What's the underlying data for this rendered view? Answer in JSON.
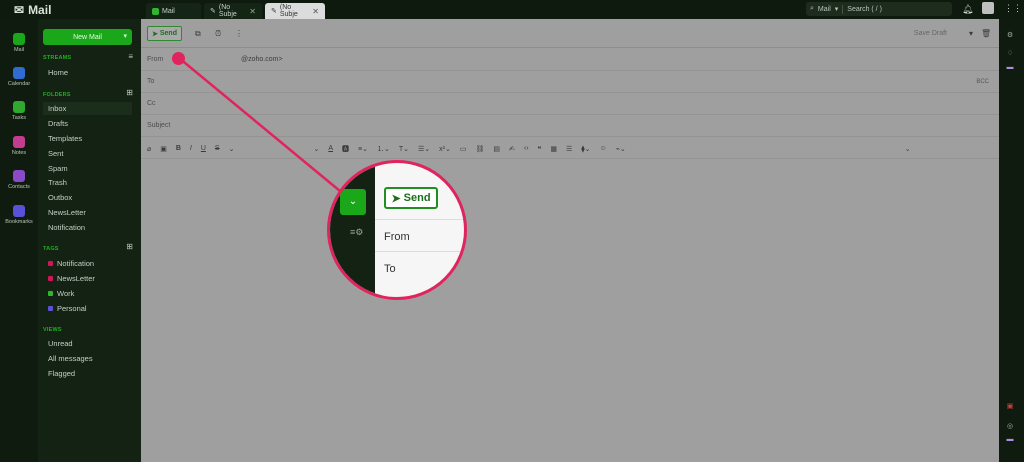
{
  "topbar": {
    "brand": "Mail",
    "tabs": [
      {
        "label": "Mail"
      },
      {
        "label": "(No Subje"
      },
      {
        "label": "(No Subje"
      }
    ],
    "search_scope": "Mail",
    "search_placeholder": "Search ( / )"
  },
  "rail": {
    "items": [
      {
        "label": "Mail",
        "color": "#1aa81a"
      },
      {
        "label": "Calendar",
        "color": "#2f6bd0"
      },
      {
        "label": "Tasks",
        "color": "#2fa82f"
      },
      {
        "label": "Notes",
        "color": "#c23d8f"
      },
      {
        "label": "Contacts",
        "color": "#8b4bc7"
      },
      {
        "label": "Bookmarks",
        "color": "#5a52d6"
      }
    ]
  },
  "panel": {
    "new_mail": "New Mail",
    "streams_heading": "STREAMS",
    "streams_items": [
      "Home"
    ],
    "folders_heading": "FOLDERS",
    "folders": [
      "Inbox",
      "Drafts",
      "Templates",
      "Sent",
      "Spam",
      "Trash",
      "Outbox",
      "NewsLetter",
      "Notification"
    ],
    "tags_heading": "TAGS",
    "tags": [
      {
        "label": "Notification",
        "color": "#d2145a"
      },
      {
        "label": "NewsLetter",
        "color": "#d2145a"
      },
      {
        "label": "Work",
        "color": "#2fb52f"
      },
      {
        "label": "Personal",
        "color": "#5a52d6"
      }
    ],
    "views_heading": "VIEWS",
    "views": [
      "Unread",
      "All messages",
      "Flagged"
    ]
  },
  "compose": {
    "send_label": "Send",
    "save_draft": "Save Draft",
    "from_label": "From",
    "from_value": "@zoho.com>",
    "to_label": "To",
    "cc_label": "Cc",
    "subject_label": "Subject",
    "bcc_label": "BCC"
  },
  "zoom": {
    "send_label": "Send",
    "from_label": "From",
    "to_label": "To"
  },
  "colors": {
    "accent": "#1aa81a",
    "highlight": "#e0245e"
  }
}
